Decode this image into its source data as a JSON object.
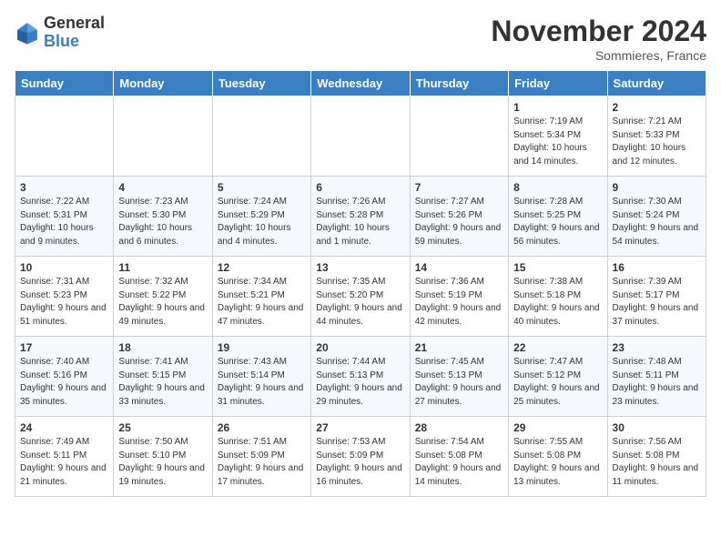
{
  "header": {
    "logo_line1": "General",
    "logo_line2": "Blue",
    "month": "November 2024",
    "location": "Sommieres, France"
  },
  "days_of_week": [
    "Sunday",
    "Monday",
    "Tuesday",
    "Wednesday",
    "Thursday",
    "Friday",
    "Saturday"
  ],
  "weeks": [
    [
      {
        "day": "",
        "sunrise": "",
        "sunset": "",
        "daylight": ""
      },
      {
        "day": "",
        "sunrise": "",
        "sunset": "",
        "daylight": ""
      },
      {
        "day": "",
        "sunrise": "",
        "sunset": "",
        "daylight": ""
      },
      {
        "day": "",
        "sunrise": "",
        "sunset": "",
        "daylight": ""
      },
      {
        "day": "",
        "sunrise": "",
        "sunset": "",
        "daylight": ""
      },
      {
        "day": "1",
        "sunrise": "Sunrise: 7:19 AM",
        "sunset": "Sunset: 5:34 PM",
        "daylight": "Daylight: 10 hours and 14 minutes."
      },
      {
        "day": "2",
        "sunrise": "Sunrise: 7:21 AM",
        "sunset": "Sunset: 5:33 PM",
        "daylight": "Daylight: 10 hours and 12 minutes."
      }
    ],
    [
      {
        "day": "3",
        "sunrise": "Sunrise: 7:22 AM",
        "sunset": "Sunset: 5:31 PM",
        "daylight": "Daylight: 10 hours and 9 minutes."
      },
      {
        "day": "4",
        "sunrise": "Sunrise: 7:23 AM",
        "sunset": "Sunset: 5:30 PM",
        "daylight": "Daylight: 10 hours and 6 minutes."
      },
      {
        "day": "5",
        "sunrise": "Sunrise: 7:24 AM",
        "sunset": "Sunset: 5:29 PM",
        "daylight": "Daylight: 10 hours and 4 minutes."
      },
      {
        "day": "6",
        "sunrise": "Sunrise: 7:26 AM",
        "sunset": "Sunset: 5:28 PM",
        "daylight": "Daylight: 10 hours and 1 minute."
      },
      {
        "day": "7",
        "sunrise": "Sunrise: 7:27 AM",
        "sunset": "Sunset: 5:26 PM",
        "daylight": "Daylight: 9 hours and 59 minutes."
      },
      {
        "day": "8",
        "sunrise": "Sunrise: 7:28 AM",
        "sunset": "Sunset: 5:25 PM",
        "daylight": "Daylight: 9 hours and 56 minutes."
      },
      {
        "day": "9",
        "sunrise": "Sunrise: 7:30 AM",
        "sunset": "Sunset: 5:24 PM",
        "daylight": "Daylight: 9 hours and 54 minutes."
      }
    ],
    [
      {
        "day": "10",
        "sunrise": "Sunrise: 7:31 AM",
        "sunset": "Sunset: 5:23 PM",
        "daylight": "Daylight: 9 hours and 51 minutes."
      },
      {
        "day": "11",
        "sunrise": "Sunrise: 7:32 AM",
        "sunset": "Sunset: 5:22 PM",
        "daylight": "Daylight: 9 hours and 49 minutes."
      },
      {
        "day": "12",
        "sunrise": "Sunrise: 7:34 AM",
        "sunset": "Sunset: 5:21 PM",
        "daylight": "Daylight: 9 hours and 47 minutes."
      },
      {
        "day": "13",
        "sunrise": "Sunrise: 7:35 AM",
        "sunset": "Sunset: 5:20 PM",
        "daylight": "Daylight: 9 hours and 44 minutes."
      },
      {
        "day": "14",
        "sunrise": "Sunrise: 7:36 AM",
        "sunset": "Sunset: 5:19 PM",
        "daylight": "Daylight: 9 hours and 42 minutes."
      },
      {
        "day": "15",
        "sunrise": "Sunrise: 7:38 AM",
        "sunset": "Sunset: 5:18 PM",
        "daylight": "Daylight: 9 hours and 40 minutes."
      },
      {
        "day": "16",
        "sunrise": "Sunrise: 7:39 AM",
        "sunset": "Sunset: 5:17 PM",
        "daylight": "Daylight: 9 hours and 37 minutes."
      }
    ],
    [
      {
        "day": "17",
        "sunrise": "Sunrise: 7:40 AM",
        "sunset": "Sunset: 5:16 PM",
        "daylight": "Daylight: 9 hours and 35 minutes."
      },
      {
        "day": "18",
        "sunrise": "Sunrise: 7:41 AM",
        "sunset": "Sunset: 5:15 PM",
        "daylight": "Daylight: 9 hours and 33 minutes."
      },
      {
        "day": "19",
        "sunrise": "Sunrise: 7:43 AM",
        "sunset": "Sunset: 5:14 PM",
        "daylight": "Daylight: 9 hours and 31 minutes."
      },
      {
        "day": "20",
        "sunrise": "Sunrise: 7:44 AM",
        "sunset": "Sunset: 5:13 PM",
        "daylight": "Daylight: 9 hours and 29 minutes."
      },
      {
        "day": "21",
        "sunrise": "Sunrise: 7:45 AM",
        "sunset": "Sunset: 5:13 PM",
        "daylight": "Daylight: 9 hours and 27 minutes."
      },
      {
        "day": "22",
        "sunrise": "Sunrise: 7:47 AM",
        "sunset": "Sunset: 5:12 PM",
        "daylight": "Daylight: 9 hours and 25 minutes."
      },
      {
        "day": "23",
        "sunrise": "Sunrise: 7:48 AM",
        "sunset": "Sunset: 5:11 PM",
        "daylight": "Daylight: 9 hours and 23 minutes."
      }
    ],
    [
      {
        "day": "24",
        "sunrise": "Sunrise: 7:49 AM",
        "sunset": "Sunset: 5:11 PM",
        "daylight": "Daylight: 9 hours and 21 minutes."
      },
      {
        "day": "25",
        "sunrise": "Sunrise: 7:50 AM",
        "sunset": "Sunset: 5:10 PM",
        "daylight": "Daylight: 9 hours and 19 minutes."
      },
      {
        "day": "26",
        "sunrise": "Sunrise: 7:51 AM",
        "sunset": "Sunset: 5:09 PM",
        "daylight": "Daylight: 9 hours and 17 minutes."
      },
      {
        "day": "27",
        "sunrise": "Sunrise: 7:53 AM",
        "sunset": "Sunset: 5:09 PM",
        "daylight": "Daylight: 9 hours and 16 minutes."
      },
      {
        "day": "28",
        "sunrise": "Sunrise: 7:54 AM",
        "sunset": "Sunset: 5:08 PM",
        "daylight": "Daylight: 9 hours and 14 minutes."
      },
      {
        "day": "29",
        "sunrise": "Sunrise: 7:55 AM",
        "sunset": "Sunset: 5:08 PM",
        "daylight": "Daylight: 9 hours and 13 minutes."
      },
      {
        "day": "30",
        "sunrise": "Sunrise: 7:56 AM",
        "sunset": "Sunset: 5:08 PM",
        "daylight": "Daylight: 9 hours and 11 minutes."
      }
    ]
  ]
}
